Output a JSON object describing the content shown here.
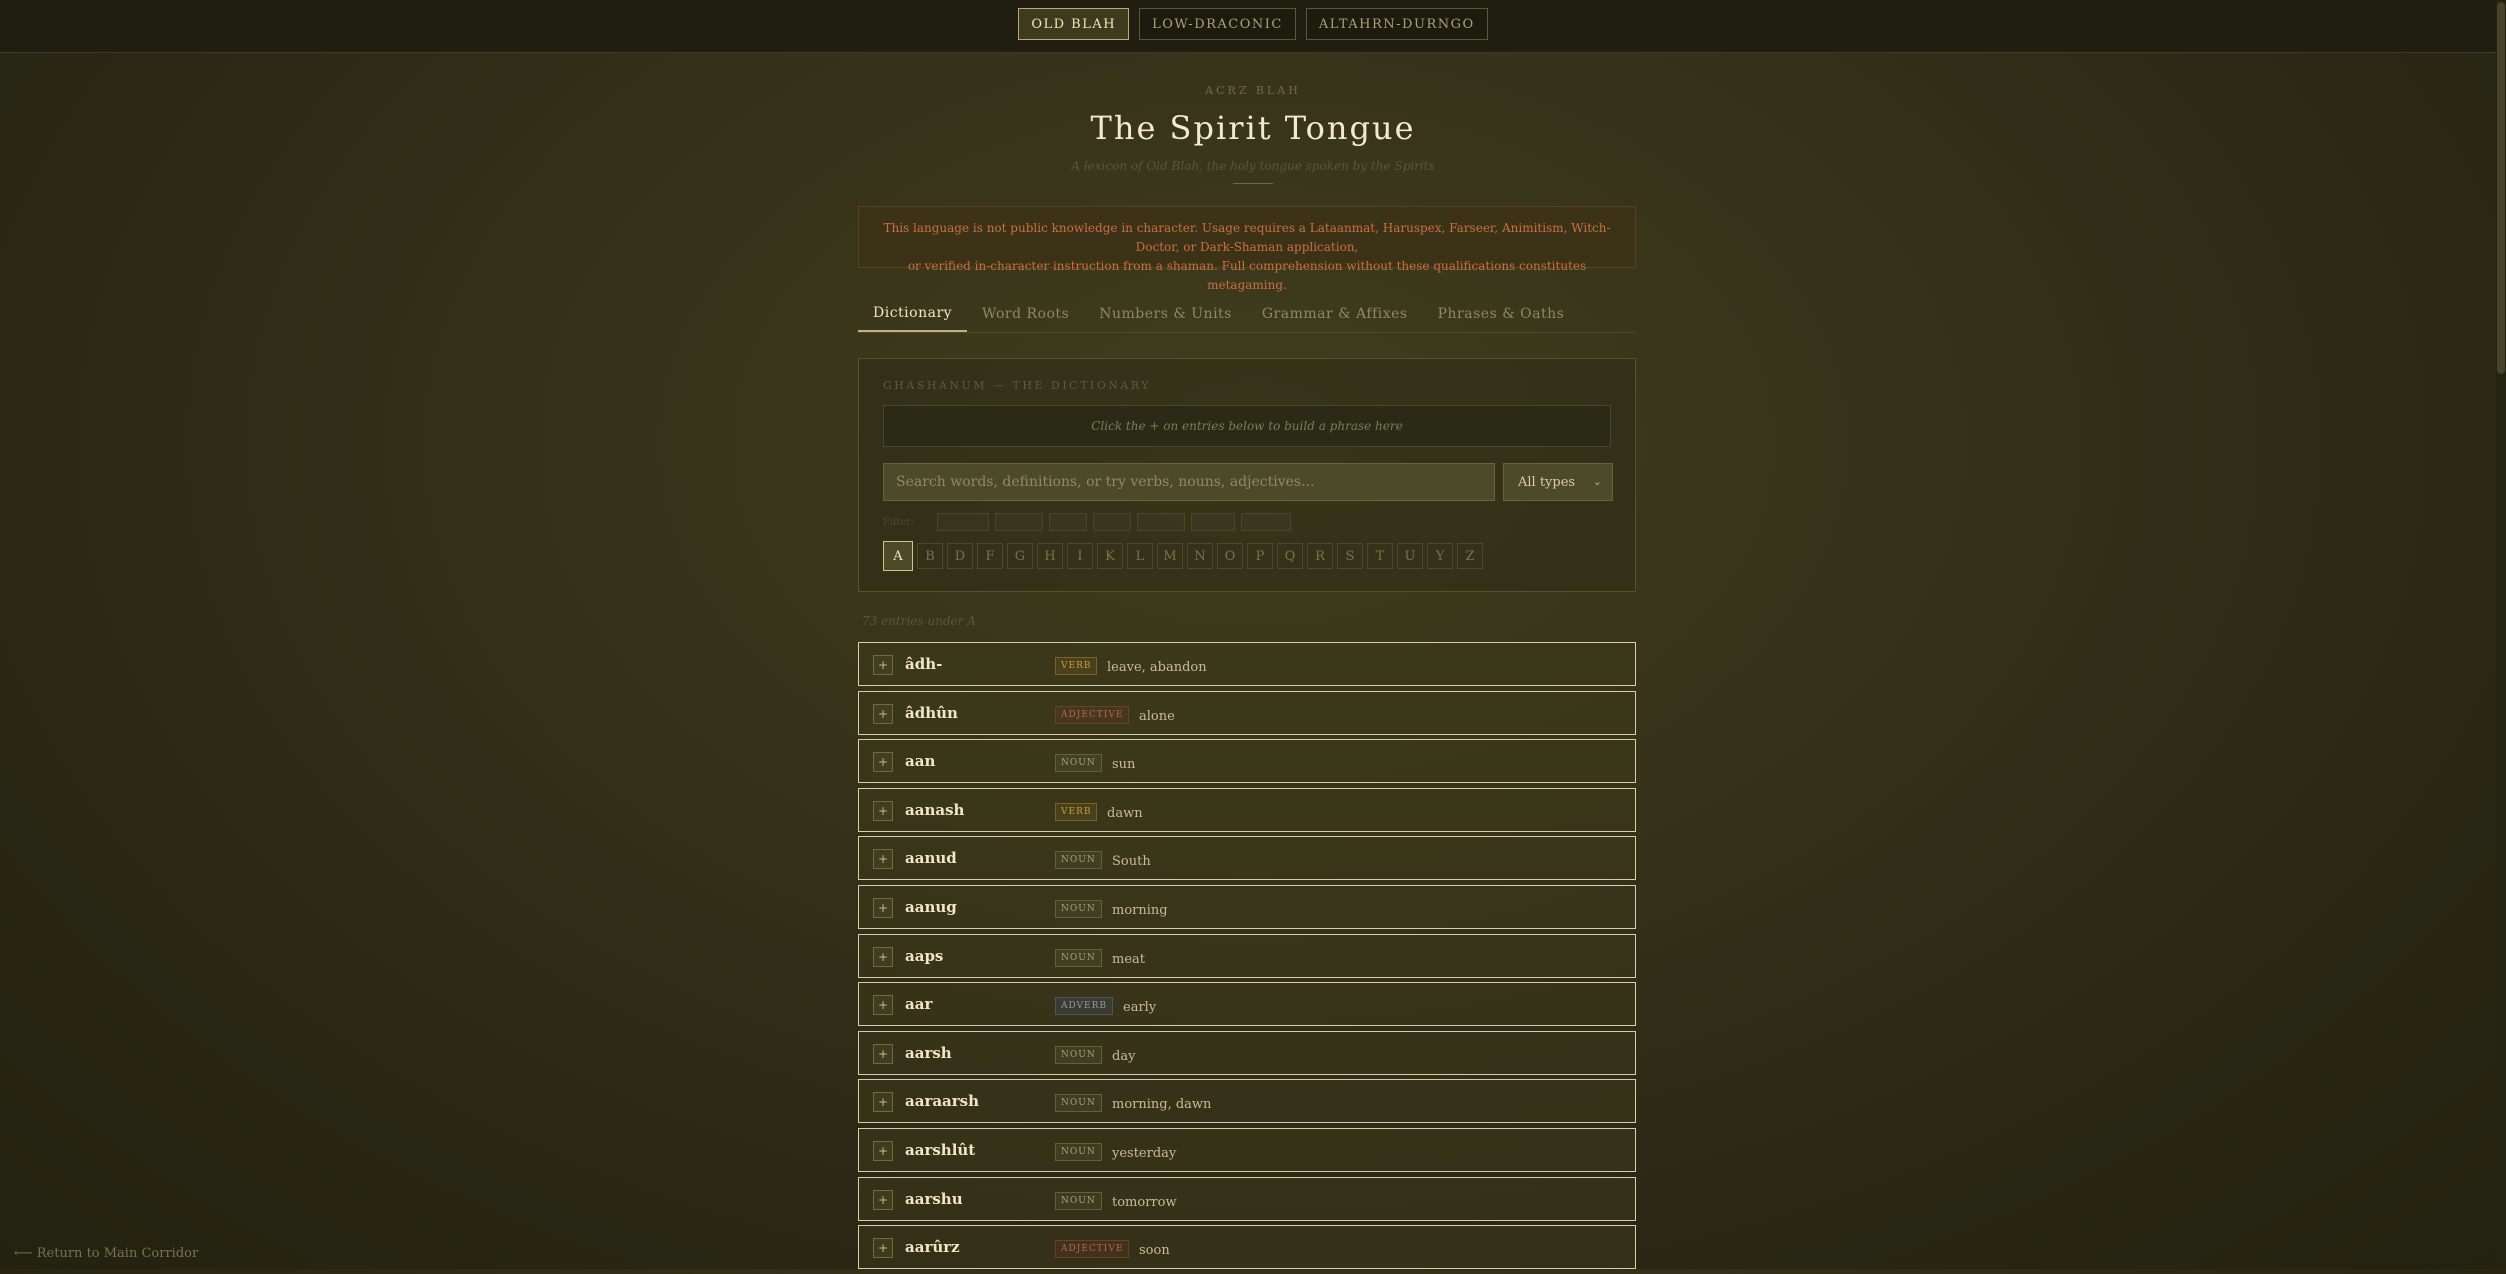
{
  "top_tabs": [
    {
      "label": "OLD BLAH",
      "active": true
    },
    {
      "label": "LOW-DRACONIC",
      "active": false
    },
    {
      "label": "ALTAHRN-DURNGO",
      "active": false
    }
  ],
  "header": {
    "eyebrow": "ACRZ BLAH",
    "title": "The Spirit Tongue",
    "subtitle": "A lexicon of Old Blah, the holy tongue spoken by the Spirits"
  },
  "warning": {
    "line1": "This language is not public knowledge in character. Usage requires a Lataanmat, Haruspex, Farseer, Animitism, Witch-Doctor, or Dark-Shaman application,",
    "line2": "or verified in-character instruction from a shaman. Full comprehension without these qualifications constitutes metagaming."
  },
  "nav_tabs": [
    {
      "label": "Dictionary",
      "active": true
    },
    {
      "label": "Word Roots",
      "active": false
    },
    {
      "label": "Numbers & Units",
      "active": false
    },
    {
      "label": "Grammar & Affixes",
      "active": false
    },
    {
      "label": "Phrases & Oaths",
      "active": false
    }
  ],
  "panel": {
    "heading": "GHASHANUM — THE DICTIONARY",
    "phrase_placeholder": "Click the + on entries below to build a phrase here",
    "search_placeholder": "Search words, definitions, or try verbs, nouns, adjectives...",
    "type_select": "All types",
    "filter_label": "Filter:"
  },
  "letters": [
    "A",
    "B",
    "D",
    "F",
    "G",
    "H",
    "I",
    "K",
    "L",
    "M",
    "N",
    "O",
    "P",
    "Q",
    "R",
    "S",
    "T",
    "U",
    "Y",
    "Z"
  ],
  "active_letter": "A",
  "count_text": "73 entries under A",
  "entries": [
    {
      "word": "âdh-",
      "pos": "VERB",
      "def": "leave, abandon"
    },
    {
      "word": "âdhûn",
      "pos": "ADJECTIVE",
      "def": "alone"
    },
    {
      "word": "aan",
      "pos": "NOUN",
      "def": "sun"
    },
    {
      "word": "aanash",
      "pos": "VERB",
      "def": "dawn"
    },
    {
      "word": "aanud",
      "pos": "NOUN",
      "def": "South"
    },
    {
      "word": "aanug",
      "pos": "NOUN",
      "def": "morning"
    },
    {
      "word": "aaps",
      "pos": "NOUN",
      "def": "meat"
    },
    {
      "word": "aar",
      "pos": "ADVERB",
      "def": "early"
    },
    {
      "word": "aarsh",
      "pos": "NOUN",
      "def": "day"
    },
    {
      "word": "aaraarsh",
      "pos": "NOUN",
      "def": "morning, dawn"
    },
    {
      "word": "aarshlût",
      "pos": "NOUN",
      "def": "yesterday"
    },
    {
      "word": "aarshu",
      "pos": "NOUN",
      "def": "tomorrow"
    },
    {
      "word": "aarûrz",
      "pos": "ADJECTIVE",
      "def": "soon"
    }
  ],
  "add_symbol": "+",
  "footer_link": "⟵ Return to Main Corridor"
}
